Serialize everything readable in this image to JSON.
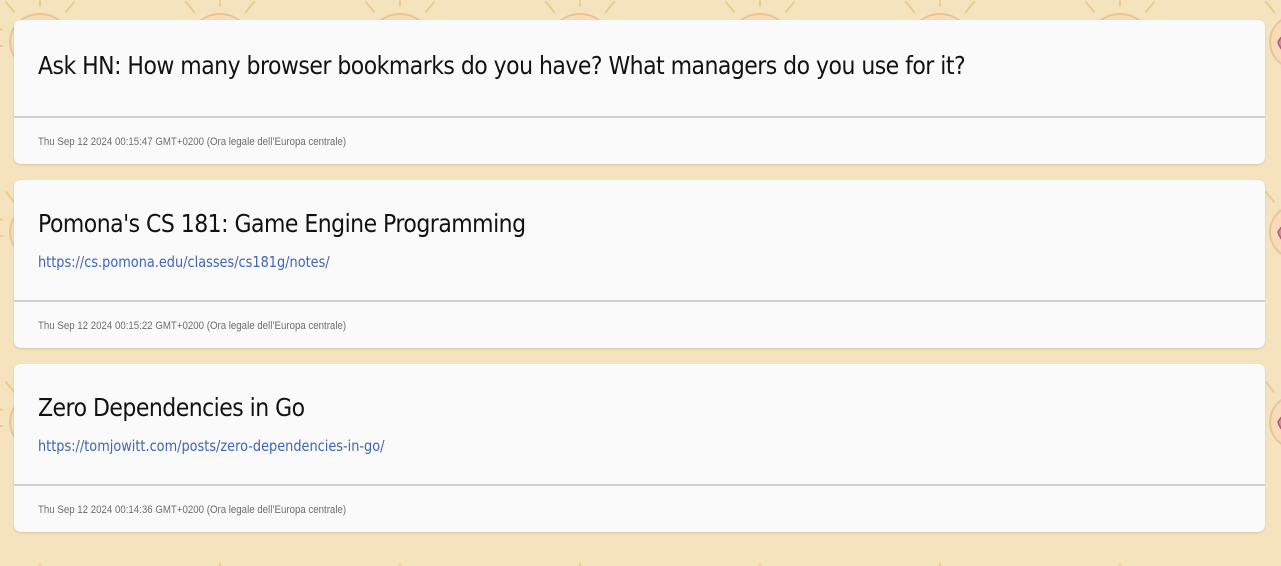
{
  "background": {
    "color": "#f4e3bd",
    "pattern": "brain-lightbulb-icon"
  },
  "posts": [
    {
      "title": "Ask HN: How many browser bookmarks do you have? What managers do you use for it?",
      "url": "",
      "date": "Thu Sep 12 2024 00:15:47 GMT+0200 (Ora legale dell’Europa centrale)"
    },
    {
      "title": "Pomona's CS 181: Game Engine Programming",
      "url": "https://cs.pomona.edu/classes/cs181g/notes/",
      "date": "Thu Sep 12 2024 00:15:22 GMT+0200 (Ora legale dell’Europa centrale)"
    },
    {
      "title": "Zero Dependencies in Go",
      "url": "https://tomjowitt.com/posts/zero-dependencies-in-go/",
      "date": "Thu Sep 12 2024 00:14:36 GMT+0200 (Ora legale dell’Europa centrale)"
    }
  ],
  "colors": {
    "card": "#fafafa",
    "title": "#121212",
    "link": "#4065b6",
    "date": "#6d6d6d",
    "divider": "#cfcfcf"
  }
}
